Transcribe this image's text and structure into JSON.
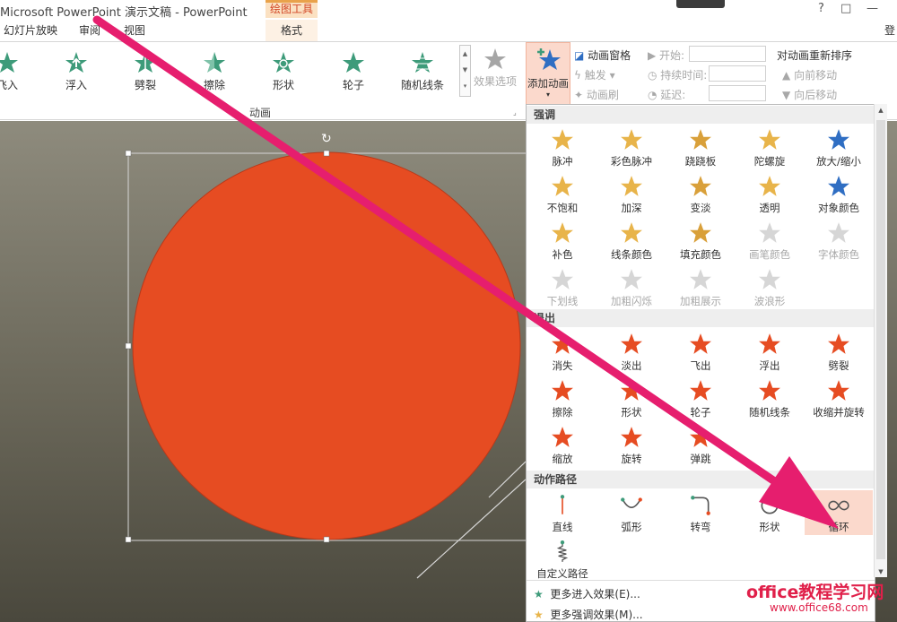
{
  "window": {
    "title": "Microsoft PowerPoint 演示文稿 - PowerPoint",
    "context_tab": "绘图工具",
    "buttons": [
      "?",
      "□",
      "—"
    ]
  },
  "tabs": [
    "幻灯片放映",
    "审阅",
    "视图",
    "格式",
    "登"
  ],
  "ribbon": {
    "gallery": [
      "飞入",
      "浮入",
      "劈裂",
      "擦除",
      "形状",
      "轮子",
      "随机线条"
    ],
    "effect_options": "效果选项",
    "add_animation": "添加动画",
    "animation_pane": "动画窗格",
    "trigger": "触发",
    "painter": "动画刷",
    "start": "开始:",
    "duration": "持续时间:",
    "delay": "延迟:",
    "reorder_title": "对动画重新排序",
    "move_earlier": "向前移动",
    "move_later": "向后移动",
    "group_label": "动画"
  },
  "dropdown": {
    "emphasis_title": "强调",
    "emphasis": [
      "脉冲",
      "彩色脉冲",
      "跷跷板",
      "陀螺旋",
      "放大/缩小",
      "不饱和",
      "加深",
      "变淡",
      "透明",
      "对象颜色",
      "补色",
      "线条颜色",
      "填充颜色",
      "画笔颜色",
      "字体颜色",
      "下划线",
      "加粗闪烁",
      "加粗展示",
      "波浪形"
    ],
    "exit_title": "退出",
    "exit": [
      "消失",
      "淡出",
      "飞出",
      "浮出",
      "劈裂",
      "擦除",
      "形状",
      "轮子",
      "随机线条",
      "收缩并旋转",
      "缩放",
      "旋转",
      "弹跳"
    ],
    "path_title": "动作路径",
    "paths": [
      "直线",
      "弧形",
      "转弯",
      "形状",
      "循环",
      "自定义路径"
    ],
    "more_entrance": "更多进入效果(E)...",
    "more_emphasis": "更多强调效果(M)..."
  },
  "watermark": {
    "site": "office教程学习网",
    "url": "www.office68.com"
  },
  "colors": {
    "circle_fill": "#e64c22",
    "arrow": "#e61e6e",
    "highlight": "#fbd9cc",
    "context_accent": "#d24726"
  }
}
